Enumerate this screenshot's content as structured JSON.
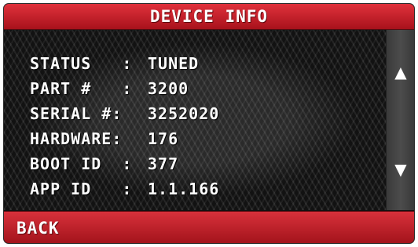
{
  "header": {
    "title": "DEVICE INFO"
  },
  "info": [
    {
      "label": "STATUS   :",
      "value": "TUNED"
    },
    {
      "label": "PART #   :",
      "value": "3200"
    },
    {
      "label": "SERIAL #:",
      "value": "3252020"
    },
    {
      "label": "HARDWARE:",
      "value": "176"
    },
    {
      "label": "BOOT ID  :",
      "value": "377"
    },
    {
      "label": "APP ID   :",
      "value": "1.1.166"
    }
  ],
  "scroll": {
    "up_icon": "▲",
    "down_icon": "▼",
    "up_icon_name": "chevron-up-icon",
    "down_icon_name": "chevron-down-icon"
  },
  "footer": {
    "back_label": "BACK"
  },
  "colors": {
    "accent": "#c41e28",
    "panel": "#1b1b1b",
    "scrollbar": "#444444",
    "text": "#ffffff"
  }
}
